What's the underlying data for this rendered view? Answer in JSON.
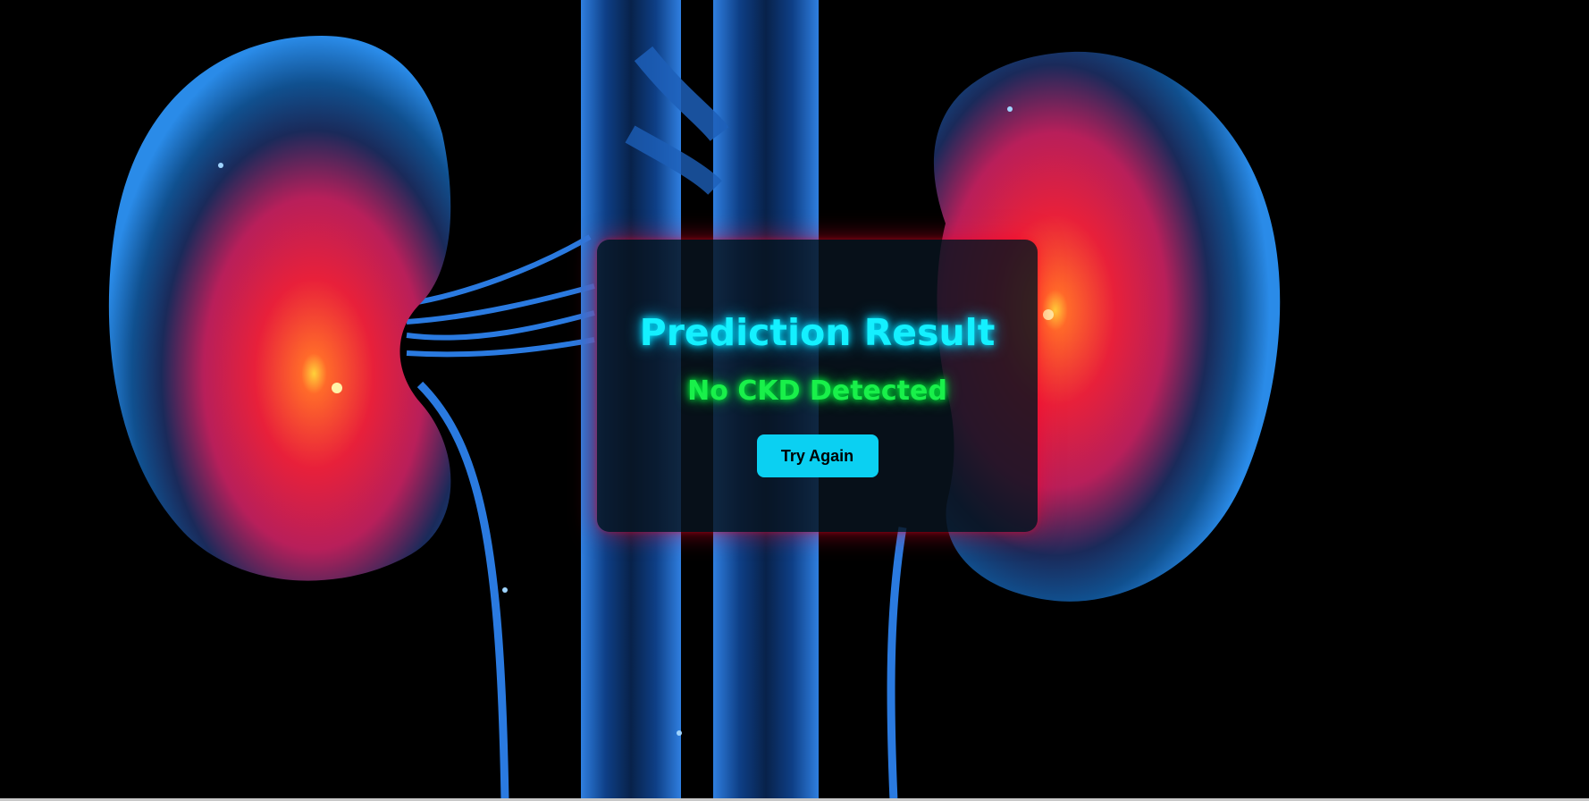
{
  "result": {
    "title": "Prediction Result",
    "status": "No CKD Detected",
    "try_again_label": "Try Again"
  },
  "colors": {
    "title": "#14f0ff",
    "status": "#19f04a",
    "button": "#0bd0f2",
    "card_glow": "#ff0028"
  },
  "background": {
    "image": "kidney-illustration"
  }
}
